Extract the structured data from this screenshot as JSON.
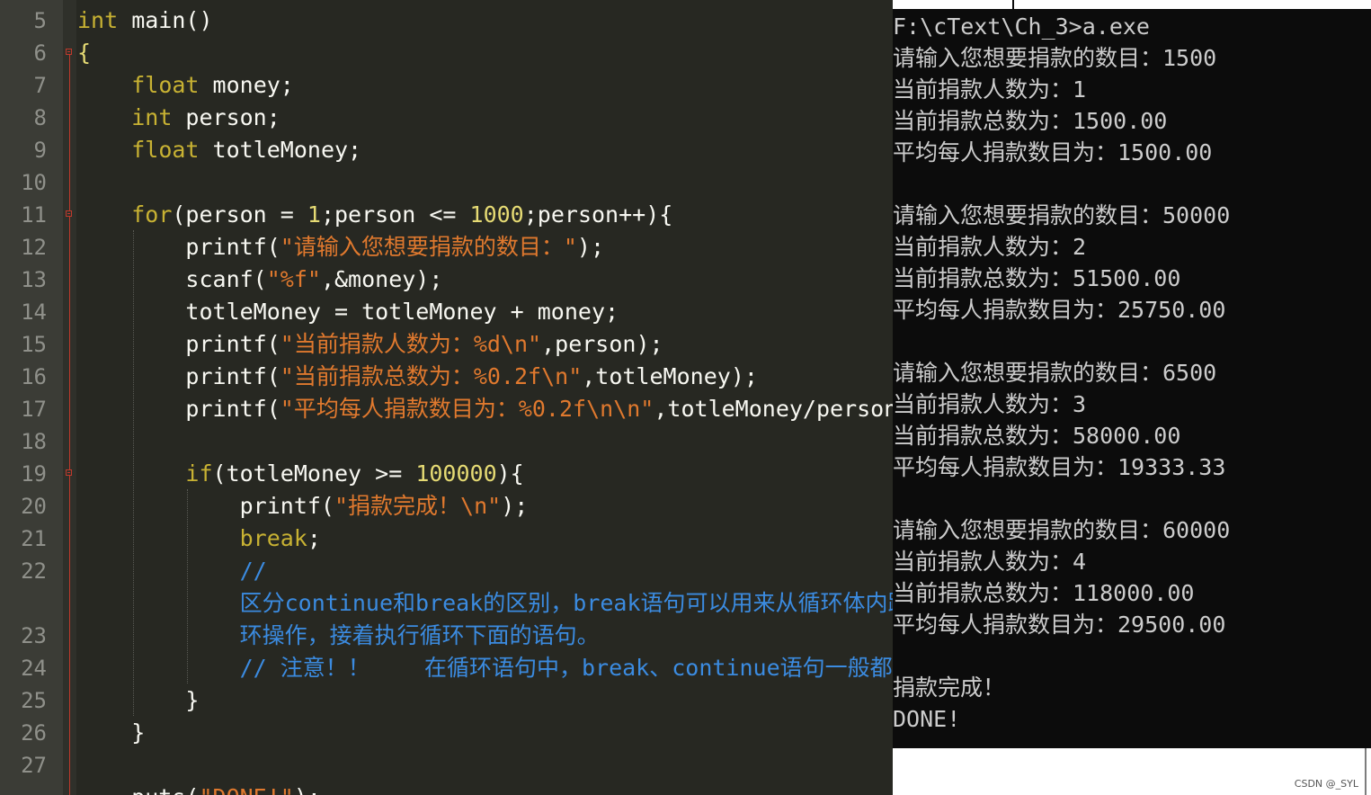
{
  "editor": {
    "line_numbers": [
      "5",
      "6",
      "7",
      "8",
      "9",
      "10",
      "11",
      "12",
      "13",
      "14",
      "15",
      "16",
      "17",
      "18",
      "19",
      "20",
      "21",
      "22",
      "",
      "23",
      "24",
      "25",
      "26",
      "27"
    ],
    "lines": [
      [
        {
          "t": "int",
          "c": "kw"
        },
        {
          "t": " main()",
          "c": "pl"
        }
      ],
      [
        {
          "t": "{",
          "c": "num"
        }
      ],
      [
        {
          "t": "    ",
          "c": "pl"
        },
        {
          "t": "float",
          "c": "kw"
        },
        {
          "t": " money;",
          "c": "pl"
        }
      ],
      [
        {
          "t": "    ",
          "c": "pl"
        },
        {
          "t": "int",
          "c": "kw"
        },
        {
          "t": " person;",
          "c": "pl"
        }
      ],
      [
        {
          "t": "    ",
          "c": "pl"
        },
        {
          "t": "float",
          "c": "kw"
        },
        {
          "t": " totleMoney;",
          "c": "pl"
        }
      ],
      [],
      [
        {
          "t": "    ",
          "c": "pl"
        },
        {
          "t": "for",
          "c": "kw"
        },
        {
          "t": "(person = ",
          "c": "pl"
        },
        {
          "t": "1",
          "c": "num"
        },
        {
          "t": ";person <= ",
          "c": "pl"
        },
        {
          "t": "1000",
          "c": "num"
        },
        {
          "t": ";person++){",
          "c": "pl"
        }
      ],
      [
        {
          "t": "        printf(",
          "c": "pl"
        },
        {
          "t": "\"请输入您想要捐款的数目：\"",
          "c": "str"
        },
        {
          "t": ");",
          "c": "pl"
        }
      ],
      [
        {
          "t": "        scanf(",
          "c": "pl"
        },
        {
          "t": "\"%f\"",
          "c": "str"
        },
        {
          "t": ",&money);",
          "c": "pl"
        }
      ],
      [
        {
          "t": "        totleMoney = totleMoney + money;",
          "c": "pl"
        }
      ],
      [
        {
          "t": "        printf(",
          "c": "pl"
        },
        {
          "t": "\"当前捐款人数为：%d\\n\"",
          "c": "str"
        },
        {
          "t": ",person);",
          "c": "pl"
        }
      ],
      [
        {
          "t": "        printf(",
          "c": "pl"
        },
        {
          "t": "\"当前捐款总数为：%0.2f\\n\"",
          "c": "str"
        },
        {
          "t": ",totleMoney);",
          "c": "pl"
        }
      ],
      [
        {
          "t": "        printf(",
          "c": "pl"
        },
        {
          "t": "\"平均每人捐款数目为：%0.2f\\n\\n\"",
          "c": "str"
        },
        {
          "t": ",totleMoney/person);",
          "c": "pl"
        }
      ],
      [],
      [
        {
          "t": "        ",
          "c": "pl"
        },
        {
          "t": "if",
          "c": "kw"
        },
        {
          "t": "(totleMoney >= ",
          "c": "pl"
        },
        {
          "t": "100000",
          "c": "num"
        },
        {
          "t": "){",
          "c": "pl"
        }
      ],
      [
        {
          "t": "            printf(",
          "c": "pl"
        },
        {
          "t": "\"捐款完成！\\n\"",
          "c": "str"
        },
        {
          "t": ");",
          "c": "pl"
        }
      ],
      [
        {
          "t": "            ",
          "c": "pl"
        },
        {
          "t": "break",
          "c": "kw"
        },
        {
          "t": ";",
          "c": "pl"
        }
      ],
      [
        {
          "t": "            //",
          "c": "cm"
        }
      ],
      [
        {
          "t": "            区分continue和break的区别，break语句可以用来从循环体内跳出循",
          "c": "cm"
        }
      ],
      [
        {
          "t": "            环操作，接着执行循环下面的语句。",
          "c": "cm"
        }
      ],
      [
        {
          "t": "            // 注意！！    在循环语句中，break、continue语句一般都",
          "c": "cm"
        }
      ],
      [
        {
          "t": "        }",
          "c": "pl"
        }
      ],
      [
        {
          "t": "    }",
          "c": "pl"
        }
      ],
      [],
      [
        {
          "t": "    puts(",
          "c": "pl"
        },
        {
          "t": "\"DONE!\"",
          "c": "str"
        },
        {
          "t": ");",
          "c": "pl"
        }
      ]
    ]
  },
  "console": {
    "lines": [
      "F:\\cText\\Ch_3>a.exe",
      "请输入您想要捐款的数目：1500",
      "当前捐款人数为：1",
      "当前捐款总数为：1500.00",
      "平均每人捐款数目为：1500.00",
      "",
      "请输入您想要捐款的数目：50000",
      "当前捐款人数为：2",
      "当前捐款总数为：51500.00",
      "平均每人捐款数目为：25750.00",
      "",
      "请输入您想要捐款的数目：6500",
      "当前捐款人数为：3",
      "当前捐款总数为：58000.00",
      "平均每人捐款数目为：19333.33",
      "",
      "请输入您想要捐款的数目：60000",
      "当前捐款人数为：4",
      "当前捐款总数为：118000.00",
      "平均每人捐款数目为：29500.00",
      "",
      "捐款完成！",
      "DONE!"
    ]
  },
  "watermark": "CSDN @_SYL"
}
